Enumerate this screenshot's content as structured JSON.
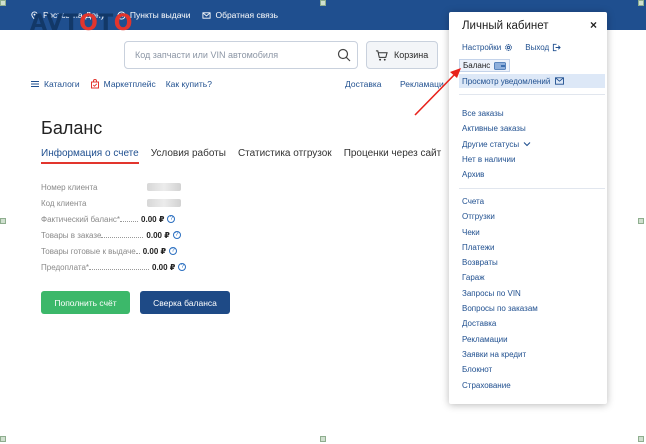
{
  "topbar": {
    "city": "Ростов-на-Дону",
    "pickup": "Пункты выдачи",
    "feedback": "Обратная связь"
  },
  "header": {
    "logo_a": "AV",
    "logo_o1": "T",
    "logo_o2": "O",
    "logo_t": "T",
    "logo_o3": "O",
    "search_placeholder": "Код запчасти или VIN автомобиля",
    "cart_label": "Корзина"
  },
  "nav": {
    "catalogs": "Каталоги",
    "marketplace": "Маркетплейс",
    "how_to_buy": "Как купить?",
    "delivery": "Доставка",
    "claims": "Рекламаци"
  },
  "main": {
    "title": "Баланс",
    "tabs": [
      {
        "label": "Информация о счете",
        "active": true
      },
      {
        "label": "Условия работы",
        "active": false
      },
      {
        "label": "Статистика отгрузок",
        "active": false
      },
      {
        "label": "Проценки через сайт",
        "active": false
      }
    ],
    "info_rows": [
      {
        "label": "Номер клиента",
        "value": ""
      },
      {
        "label": "Код клиента",
        "value": ""
      },
      {
        "label": "Фактический баланс*",
        "value": "0.00 ₽"
      },
      {
        "label": "Товары в заказе",
        "value": "0.00 ₽"
      },
      {
        "label": "Товары готовые к выдаче",
        "value": "0.00 ₽"
      },
      {
        "label": "Предоплата*",
        "value": "0.00 ₽"
      }
    ],
    "question_mark": "?",
    "topup_button": "Пополнить счёт",
    "reconcile_button": "Сверка баланса"
  },
  "dropdown": {
    "title": "Личный кабинет",
    "close": "×",
    "settings": "Настройки",
    "logout": "Выход",
    "balance": "Баланс",
    "notifications": "Просмотр уведомлений",
    "orders_group": [
      "Все заказы",
      "Активные заказы",
      "Другие статусы",
      "Нет в наличии",
      "Архив"
    ],
    "docs_group": [
      "Счета",
      "Отгрузки",
      "Чеки",
      "Платежи",
      "Возвраты",
      "Гараж",
      "Запросы по VIN",
      "Вопросы по заказам",
      "Доставка",
      "Рекламации",
      "Заявки на кредит",
      "Блокнот",
      "Страхование"
    ]
  },
  "colors": {
    "brand_blue": "#1f4f8f",
    "brand_red": "#e2352d",
    "green": "#3cb86a",
    "arrow": "#e8221b"
  }
}
